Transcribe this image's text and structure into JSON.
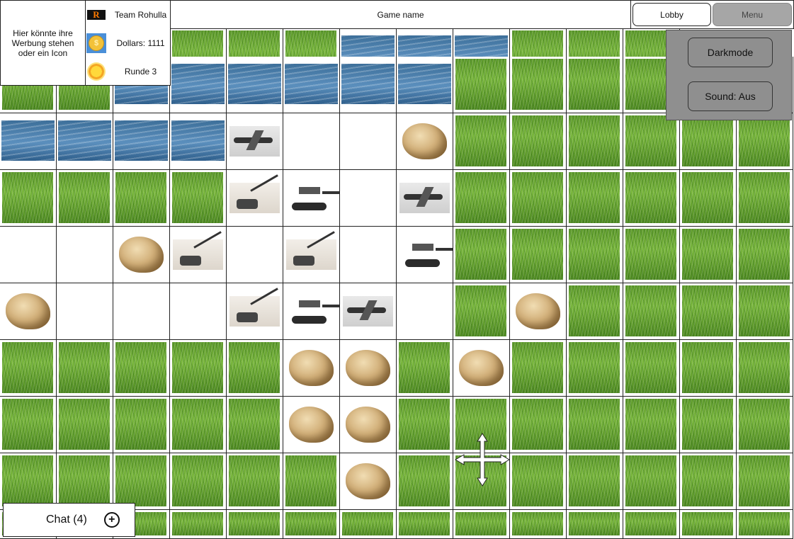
{
  "ad": {
    "text": "Hier könnte ihre Werbung stehen oder ein Icon"
  },
  "team": {
    "name": "Team Rohulla",
    "icon": "team-logo-icon",
    "icon_letter": "R"
  },
  "dollars": {
    "label": "Dollars: 1111",
    "icon": "coin-icon"
  },
  "round": {
    "label": "Runde 3",
    "icon": "sun-icon"
  },
  "header": {
    "game_name": "Game name"
  },
  "nav": {
    "lobby": "Lobby",
    "menu": "Menu"
  },
  "menu_panel": {
    "darkmode": "Darkmode",
    "sound": "Sound: Aus"
  },
  "chat": {
    "label": "Chat (4)",
    "add": "+"
  },
  "colors": {
    "grass": "#5e9a2c",
    "water": "#3d6f9a",
    "menu_bg": "#8f8f8f",
    "menu_button": "#a6a6a6"
  },
  "board": {
    "columns": 14,
    "rows": 10,
    "legend": {
      "G": "grass",
      "W": "water",
      "R": "rock",
      "T": "tank",
      "P": "plane",
      "A": "artillery",
      "E": "empty",
      "X": "occupied-by-panel"
    },
    "grid": [
      "XXXGGGWWWGGGXX",
      "GGWWWWWWGGGGGG",
      "WWWWPEERGGGGGG",
      "GGGGATEPGGGGGG",
      "EERAEAETGGGGGG",
      "REEEATPEGRGGGG",
      "GGGGGRRGRGGGGG",
      "GGGGGRRGGGGGGG",
      "GGGGGGRGGGGGGG",
      "GGGGGGGGGGGGGG"
    ]
  }
}
